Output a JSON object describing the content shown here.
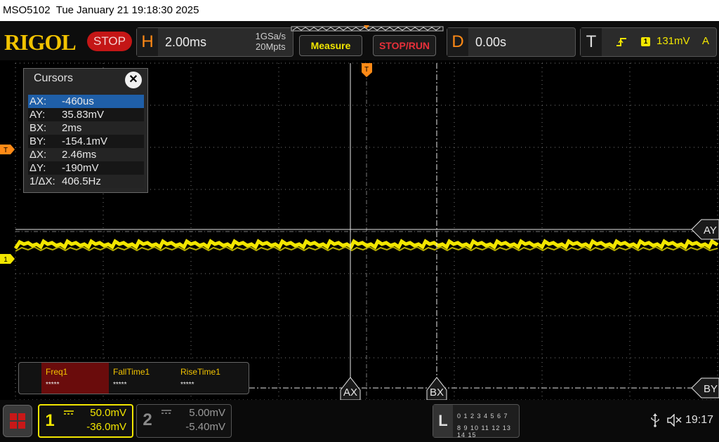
{
  "title_bar": {
    "model": "MSO5102",
    "datetime": "Tue January 21 19:18:30 2025"
  },
  "brand": {
    "logo": "RIGOL",
    "run_state": "STOP",
    "logo_color": "#f2c300",
    "stop_color": "#c41616"
  },
  "horizontal": {
    "letter": "H",
    "scale": "2.00ms",
    "sample_rate": "1GSa/s",
    "memory_depth": "20Mpts"
  },
  "buttons": {
    "measure": "Measure",
    "stop_run": "STOP/RUN"
  },
  "delay": {
    "letter": "D",
    "value": "0.00s"
  },
  "trigger": {
    "letter": "T",
    "channel_badge": "1",
    "level": "131mV",
    "mode": "A",
    "edge_icon": "rising-edge-icon"
  },
  "cursors": {
    "title": "Cursors",
    "rows": [
      {
        "key": "AX:",
        "value": "-460us",
        "selected": true
      },
      {
        "key": "AY:",
        "value": "35.83mV"
      },
      {
        "key": "BX:",
        "value": "2ms"
      },
      {
        "key": "BY:",
        "value": "-154.1mV"
      },
      {
        "key": "ΔX:",
        "value": "2.46ms"
      },
      {
        "key": "ΔY:",
        "value": "-190mV"
      },
      {
        "key": "1/ΔX:",
        "value": "406.5Hz"
      }
    ]
  },
  "markers": {
    "trigger_left": "T",
    "trigger_top": "T",
    "channel1": "1",
    "ay": "AY",
    "by": "BY",
    "ax": "AX",
    "bx": "BX"
  },
  "measurements": [
    {
      "name": "Freq1",
      "value": "*****",
      "active": true
    },
    {
      "name": "FallTime1",
      "value": "*****"
    },
    {
      "name": "RiseTime1",
      "value": "*****"
    }
  ],
  "channel1": {
    "number": "1",
    "scale": "50.0mV",
    "offset": "-36.0mV",
    "color": "#f2e600"
  },
  "channel2": {
    "number": "2",
    "scale": "5.00mV",
    "offset": "-5.40mV"
  },
  "digital": {
    "letter": "L",
    "row1": "0 1 2 3  4 5 6 7",
    "row2": "8 9 10 11 12 13 14 15"
  },
  "status": {
    "time": "19:17",
    "usb_icon": "usb-icon",
    "sound_icon": "muted-speaker-icon"
  },
  "colors": {
    "accent_orange": "#ff8a16",
    "trace_yellow": "#f2e600",
    "grid": "#7a7a7a"
  }
}
